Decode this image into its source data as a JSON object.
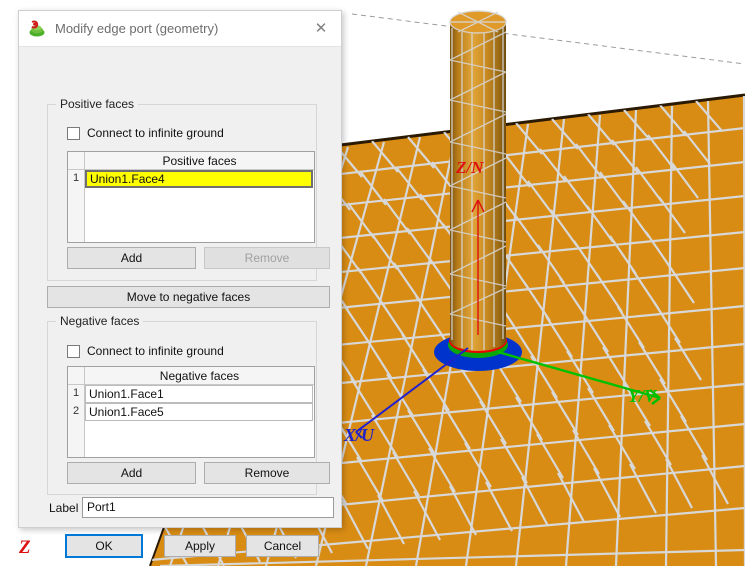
{
  "window": {
    "title": "Modify edge port (geometry)",
    "icon": "comsol-port-icon",
    "close_glyph": "✕"
  },
  "positive_group": {
    "title": "Positive faces",
    "connect_ground": {
      "label": "Connect to infinite ground",
      "checked": false
    },
    "table": {
      "header": "Positive faces",
      "rows": [
        {
          "index": "1",
          "value": "Union1.Face4",
          "editing": true
        }
      ]
    },
    "add_button": "Add",
    "remove_button": "Remove",
    "remove_enabled": false
  },
  "move_button": "Move to negative faces",
  "negative_group": {
    "title": "Negative faces",
    "connect_ground": {
      "label": "Connect to infinite ground",
      "checked": false
    },
    "table": {
      "header": "Negative faces",
      "rows": [
        {
          "index": "1",
          "value": "Union1.Face1",
          "editing": false
        },
        {
          "index": "2",
          "value": "Union1.Face5",
          "editing": false
        }
      ]
    },
    "add_button": "Add",
    "remove_button": "Remove",
    "remove_enabled": true
  },
  "label_field": {
    "caption": "Label",
    "value": "Port1",
    "placeholder": ""
  },
  "footer": {
    "ok": "OK",
    "apply": "Apply",
    "cancel": "Cancel"
  },
  "viewport": {
    "axis_x_label": "X/U",
    "axis_y_label": "Y/V",
    "axis_z_label": "Z/N",
    "axis_z_global_label": "Z",
    "colors": {
      "mesh_fill": "#d98c14",
      "mesh_edge": "#d0d0d0",
      "axis_x": "#2222cc",
      "axis_y": "#00c000",
      "axis_z": "#dd1111",
      "port_disc": "#0033cc",
      "port_ring": "#ee0000",
      "cylinder": "#c8821a"
    }
  }
}
